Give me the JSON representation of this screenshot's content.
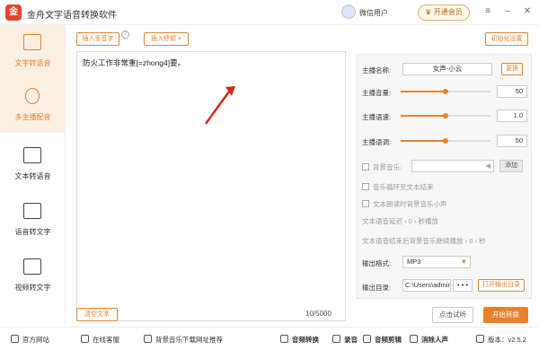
{
  "app": {
    "title": "金舟文字语音转换软件",
    "logo_text": "金"
  },
  "user": {
    "name": "微信用户",
    "vip_label": "开通会员"
  },
  "window": {
    "menu_icon": "menu-icon",
    "min_icon": "minimize-icon",
    "close_icon": "close-icon"
  },
  "sidebar": {
    "items": [
      {
        "label": "文字转语音",
        "icon": "text-to-speech-icon",
        "active": true
      },
      {
        "label": "多主播配音",
        "icon": "multi-anchor-icon",
        "active": true
      },
      {
        "label": "文本转语音",
        "icon": "doc-to-speech-icon",
        "active": false
      },
      {
        "label": "语音转文字",
        "icon": "speech-to-text-icon",
        "active": false
      },
      {
        "label": "视频转文字",
        "icon": "video-to-text-icon",
        "active": false
      }
    ]
  },
  "editor": {
    "insert_polyphone": "插入多音字",
    "insert_pause": "插入停顿 >",
    "init_settings": "初始化设置",
    "text": "防火工作非常重[=zhong4]要。",
    "char_count": "10/5000",
    "clear_label": "清空文本"
  },
  "panel": {
    "anchor_name_label": "主播名称:",
    "anchor_name_value": "女声-小云",
    "change_label": "更换",
    "volume_label": "主播音量:",
    "volume_value": "50",
    "volume_level": 0.5,
    "speed_label": "主播语速:",
    "speed_value": "1.0",
    "speed_level": 0.5,
    "pitch_label": "主播语调:",
    "pitch_value": "50",
    "pitch_level": 0.5,
    "bg_music_label": "背景音乐:",
    "add_label": "添加",
    "loop_label": "音乐循环至文本结束",
    "lower_label": "文本朗读时背景音乐小声",
    "delay_label": "文本语音延迟",
    "delay_value": "0",
    "delay_suffix": "秒播放",
    "continue_label": "文本语音结束后背景音乐继续播放",
    "continue_value": "0",
    "continue_suffix": "秒",
    "format_label": "输出格式:",
    "format_value": "MP3",
    "dir_label": "输出目录:",
    "dir_value": "C:\\Users\\admin",
    "dir_more": "• • •",
    "open_dir_label": "打开输出目录",
    "preview_label": "点击试听",
    "convert_label": "开始转换"
  },
  "footer": {
    "items": [
      {
        "label": "官方网站",
        "icon": "home-icon"
      },
      {
        "label": "在线客服",
        "icon": "support-icon"
      },
      {
        "label": "背景音乐下载网址推荐",
        "icon": "music-icon"
      },
      {
        "label": "音频转换",
        "icon": "audio-convert-icon"
      },
      {
        "label": "录音",
        "icon": "mic-icon"
      },
      {
        "label": "音频剪辑",
        "icon": "audio-cut-icon"
      },
      {
        "label": "消除人声",
        "icon": "vocal-remove-icon"
      }
    ],
    "version": "版本：v2.5.2"
  },
  "colors": {
    "accent": "#e9812a",
    "active_bg": "#fbeee3"
  }
}
